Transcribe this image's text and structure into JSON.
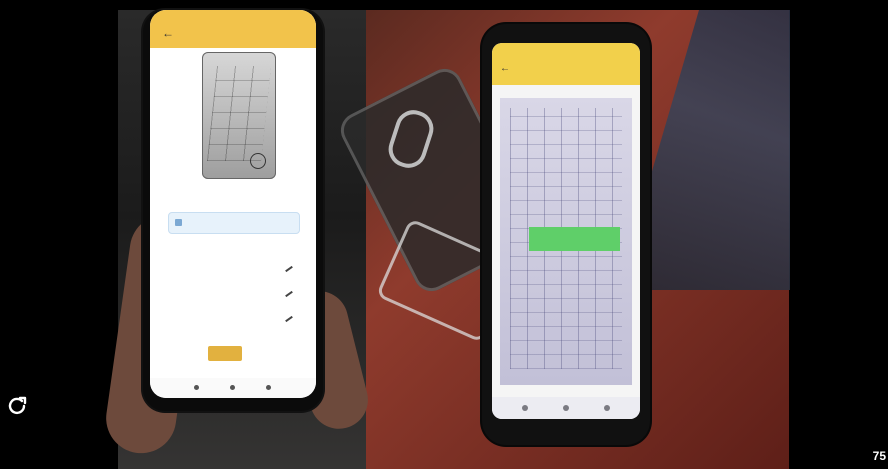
{
  "left_phone": {
    "screen_title": "",
    "hint_text": "",
    "info_text": "",
    "instruction_text": "",
    "list_items": [
      "",
      "",
      ""
    ],
    "prompt_text": "",
    "button_label": ""
  },
  "right_phone": {
    "screen_title": "",
    "overlay_text": ""
  },
  "corner_text": "75"
}
